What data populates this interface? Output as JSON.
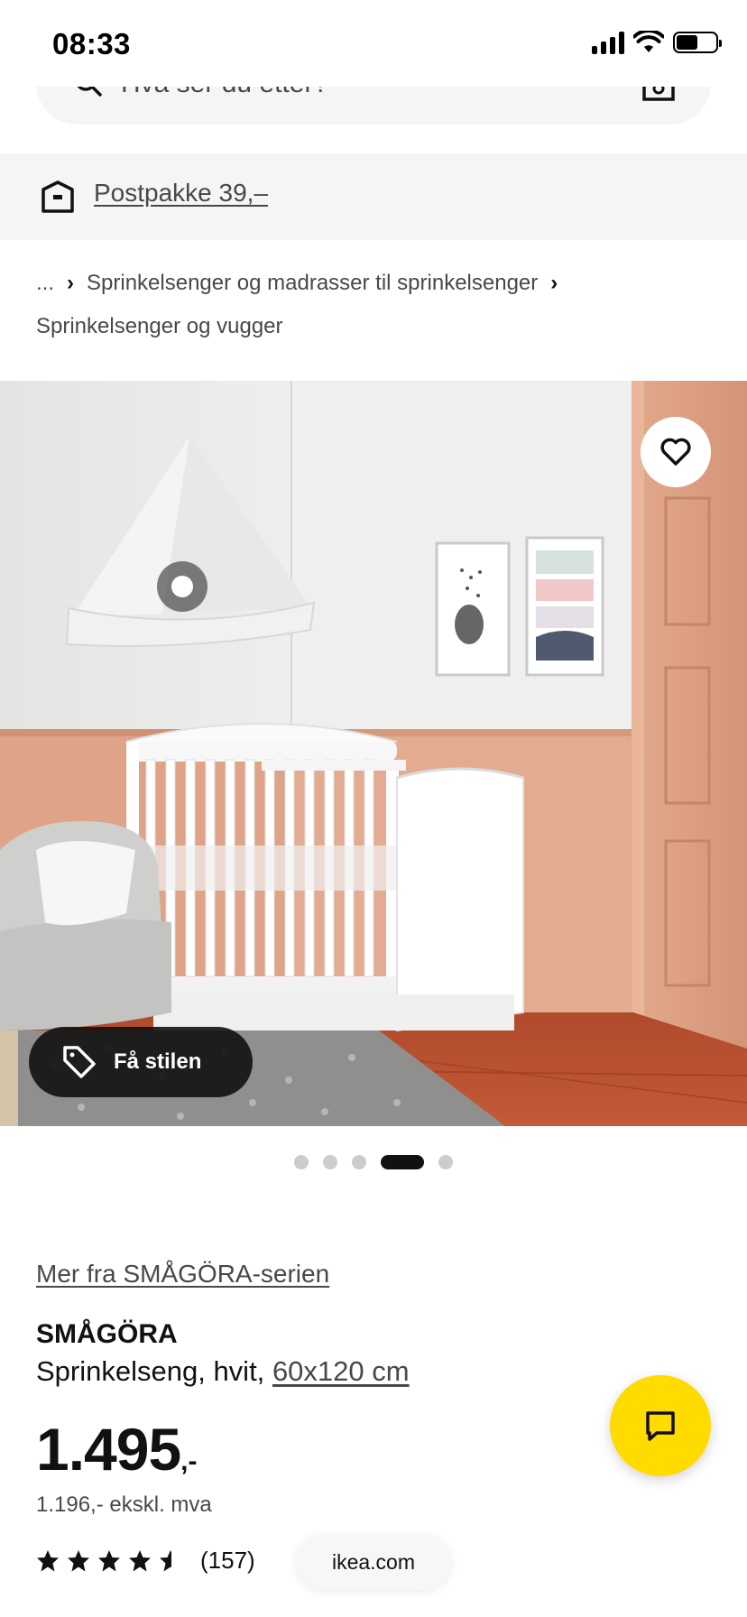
{
  "status_bar": {
    "time": "08:33",
    "icons": [
      "signal-icon",
      "wifi-icon",
      "battery-icon"
    ],
    "battery_level": 0.55
  },
  "search": {
    "placeholder": "Hva ser du etter?",
    "left_icon": "search-icon",
    "right_icon": "camera-icon"
  },
  "delivery": {
    "icon": "delivery-box-icon",
    "label": "Postpakke 39,–"
  },
  "breadcrumb": {
    "ellipsis": "...",
    "level1": "Sprinkelsenger og madrasser til sprinkelsenger",
    "level2": "Sprinkelsenger og vugger"
  },
  "product_image": {
    "style_button": "Få stilen",
    "favorite_icon": "heart-icon",
    "tag_icon": "tag-icon",
    "carousel": {
      "total": 5,
      "active_index": 3
    }
  },
  "product": {
    "series_link": "Mer fra SMÅGÖRA-serien",
    "name": "SMÅGÖRA",
    "description": "Sprinkelseng, hvit,",
    "size": "60x120 cm",
    "price": "1.495",
    "price_suffix": ",-",
    "price_ex_vat": "1.196,- ekskl. mva",
    "rating": 4.5,
    "review_count": "(157)"
  },
  "browser": {
    "url": "ikea.com"
  },
  "chat": {
    "icon": "chat-icon"
  },
  "colors": {
    "ikea_yellow": "#ffdb00",
    "text_dark": "#111111",
    "text_muted": "#484848",
    "banner_bg": "#f5f5f5"
  }
}
